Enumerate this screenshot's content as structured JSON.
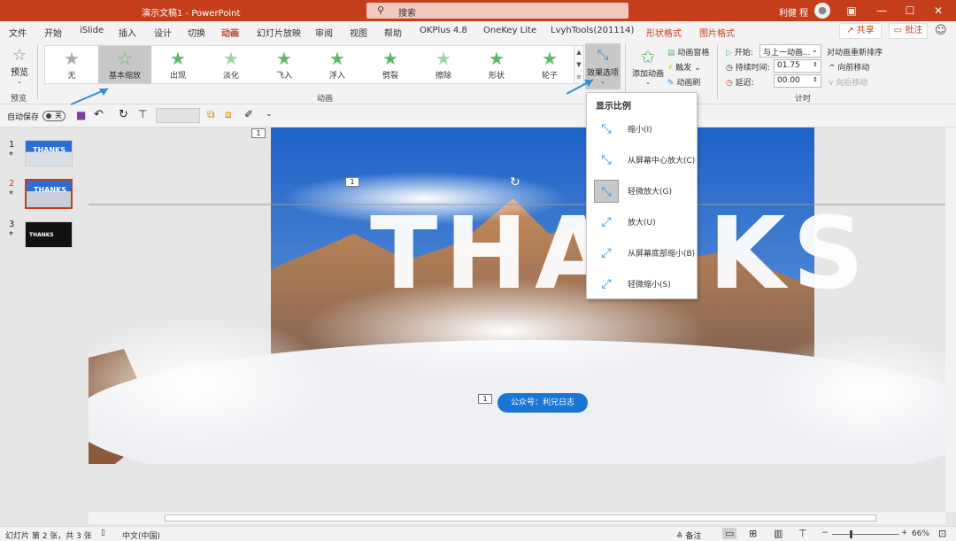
{
  "app": {
    "title": "演示文稿1  -  PowerPoint",
    "search_placeholder": "搜索",
    "user": "利健 程",
    "accent": "#c43e1c"
  },
  "tabs": [
    "文件",
    "开始",
    "iSlide",
    "插入",
    "设计",
    "切换",
    "动画",
    "幻灯片放映",
    "审阅",
    "视图",
    "帮助",
    "OKPlus 4.8",
    "OneKey Lite",
    "LvyhTools(201114)",
    "形状格式",
    "图片格式"
  ],
  "top_buttons": {
    "share": "共享",
    "comment": "批注"
  },
  "ribbon": {
    "preview": "预览",
    "preview_group": "预览",
    "animation_group": "动画",
    "timing_group": "计时",
    "gallery": [
      {
        "label": "无"
      },
      {
        "label": "基本缩放",
        "selected": true
      },
      {
        "label": "出现"
      },
      {
        "label": "淡化"
      },
      {
        "label": "飞入"
      },
      {
        "label": "浮入"
      },
      {
        "label": "劈裂"
      },
      {
        "label": "擦除"
      },
      {
        "label": "形状"
      },
      {
        "label": "轮子"
      }
    ],
    "effect_options": "效果选项",
    "add_animation": "添加动画",
    "animation_pane": "动画窗格",
    "trigger": "触发",
    "animation_painter": "动画刷",
    "start_label": "开始:",
    "start_value": "与上一动画...",
    "duration_label": "持续时间:",
    "duration_value": "01.75",
    "delay_label": "延迟:",
    "delay_value": "00.00",
    "reorder_title": "对动画重新排序",
    "move_earlier": "向前移动",
    "move_later": "向后移动"
  },
  "qat": {
    "autosave": "自动保存",
    "toggle": "关"
  },
  "slides": [
    {
      "num": "1"
    },
    {
      "num": "2"
    },
    {
      "num": "3"
    }
  ],
  "slide": {
    "headline": "THANKS",
    "tag": "公众号：利兄日志",
    "badge": "1"
  },
  "dropdown": {
    "heading": "显示比例",
    "items": [
      {
        "label": "缩小(I)"
      },
      {
        "label": "从屏幕中心放大(C)"
      },
      {
        "label": "轻微放大(G)",
        "selected": true
      },
      {
        "label": "放大(U)"
      },
      {
        "label": "从屏幕底部缩小(B)"
      },
      {
        "label": "轻微缩小(S)"
      }
    ]
  },
  "status": {
    "slide_info": "幻灯片 第 2 张，共 3 张",
    "language": "中文(中国)",
    "notes": "备注",
    "zoom": "66%"
  }
}
